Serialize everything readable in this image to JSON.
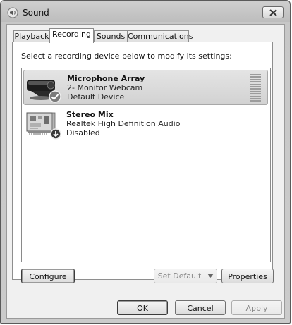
{
  "window": {
    "title": "Sound",
    "icon": "speaker-icon",
    "close_icon": "close-icon"
  },
  "tabs": [
    {
      "label": "Playback",
      "active": false
    },
    {
      "label": "Recording",
      "active": true
    },
    {
      "label": "Sounds",
      "active": false
    },
    {
      "label": "Communications",
      "active": false
    }
  ],
  "panel": {
    "instructions": "Select a recording device below to modify its settings:"
  },
  "devices": [
    {
      "name": "Microphone Array",
      "description": "2- Monitor Webcam",
      "status": "Default Device",
      "icon": "webcam-icon",
      "badge": "checkmark-icon",
      "selected": true
    },
    {
      "name": "Stereo Mix",
      "description": "Realtek High Definition Audio",
      "status": "Disabled",
      "icon": "sound-card-icon",
      "badge": "disabled-arrow-icon",
      "selected": false
    }
  ],
  "panel_buttons": {
    "configure": "Configure",
    "set_default": "Set Default",
    "properties": "Properties"
  },
  "dialog_buttons": {
    "ok": "OK",
    "cancel": "Cancel",
    "apply": "Apply"
  }
}
